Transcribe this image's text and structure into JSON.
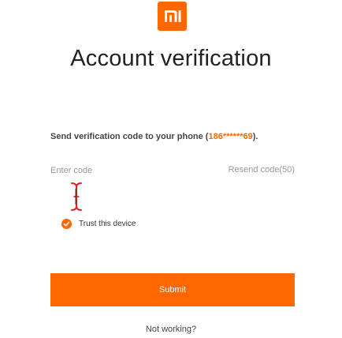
{
  "brand": {
    "logo_icon": "mi-logo-icon",
    "accent_color": "#ff6700"
  },
  "header": {
    "title": "Account verification"
  },
  "instructions": {
    "prefix": "Send verification code to your phone (",
    "phone": "186******69",
    "suffix": ")."
  },
  "code_field": {
    "value": "",
    "placeholder": "Enter code",
    "resend_label": "Resend code(50)"
  },
  "cursor": {
    "icon": "text-cursor-icon"
  },
  "trust_device": {
    "checked": true,
    "label": "Trust this device"
  },
  "submit": {
    "label": "Submit"
  },
  "help": {
    "label": "Not working?"
  }
}
